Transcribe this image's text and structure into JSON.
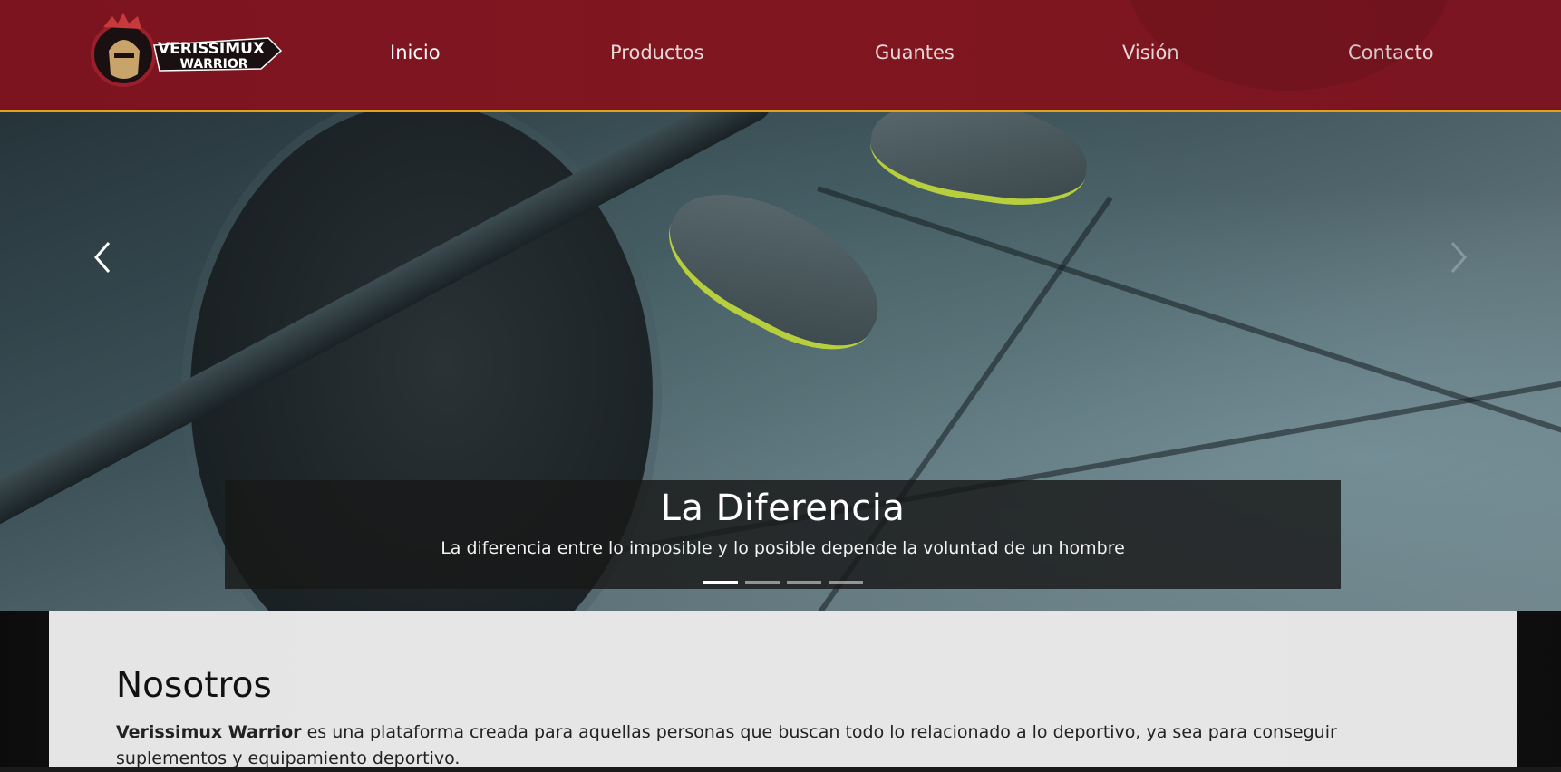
{
  "brand": {
    "logo_text_line1": "VERISSIMUX",
    "logo_text_line2": "WARRIOR"
  },
  "nav": {
    "items": [
      {
        "label": "Inicio",
        "active": true
      },
      {
        "label": "Productos",
        "active": false
      },
      {
        "label": "Guantes",
        "active": false
      },
      {
        "label": "Visión",
        "active": false
      },
      {
        "label": "Contacto",
        "active": false
      }
    ]
  },
  "carousel": {
    "caption_title": "La Diferencia",
    "caption_text": "La diferencia entre lo imposible y lo posible depende la voluntad de un hombre",
    "slide_count": 4,
    "active_slide": 1
  },
  "about": {
    "heading": "Nosotros",
    "brand_name": "Verissimux Warrior",
    "text": " es una plataforma creada para aquellas personas que buscan todo lo relacionado a lo deportivo, ya sea para conseguir suplementos y equipamiento deportivo."
  },
  "colors": {
    "navbar": "#7c1420",
    "navbar_border": "#e0a11b"
  },
  "icons": {
    "prev": "chevron-left-icon",
    "next": "chevron-right-icon"
  }
}
